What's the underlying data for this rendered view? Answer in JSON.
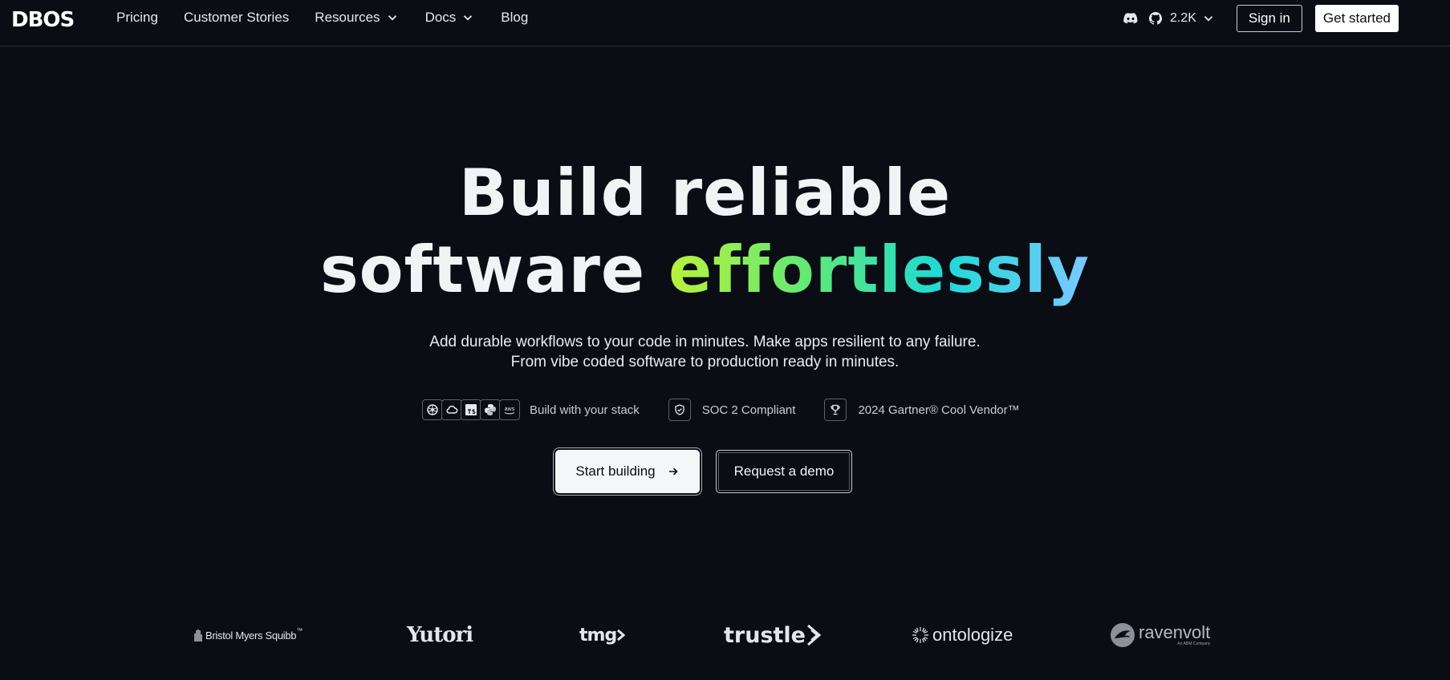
{
  "nav": {
    "logo": "DBOS",
    "links": [
      {
        "label": "Pricing"
      },
      {
        "label": "Customer Stories"
      },
      {
        "label": "Resources"
      },
      {
        "label": "Docs"
      },
      {
        "label": "Blog"
      }
    ],
    "github_stars": "2.2K",
    "sign_in": "Sign in",
    "get_started": "Get started"
  },
  "hero": {
    "title_line1": "Build reliable",
    "title_line2_plain": "software ",
    "title_line2_gradient": "effortlessly",
    "subtitle_line1": "Add durable workflows to your code in minutes. Make apps resilient to any failure.",
    "subtitle_line2": "From vibe coded software to production ready in minutes.",
    "badges": {
      "stack": "Build with your stack",
      "soc2": "SOC 2 Compliant",
      "gartner": "2024 Gartner® Cool Vendor™"
    },
    "cta_primary": "Start building",
    "cta_secondary": "Request a demo"
  },
  "customers": {
    "bms": "Bristol Myers Squibb",
    "bms_mark": "™",
    "yutori": "Yutori",
    "tmg": "tmg",
    "trustle": "trustle",
    "ontologize": "ontologize",
    "ravenvolt": "ravenvolt",
    "ravenvolt_sub": "An ABM Company"
  },
  "colors": {
    "background": "#0a0d14",
    "gradient": [
      "#b9f23a",
      "#5ce87a",
      "#1fd9d6",
      "#7cc8ff"
    ]
  }
}
